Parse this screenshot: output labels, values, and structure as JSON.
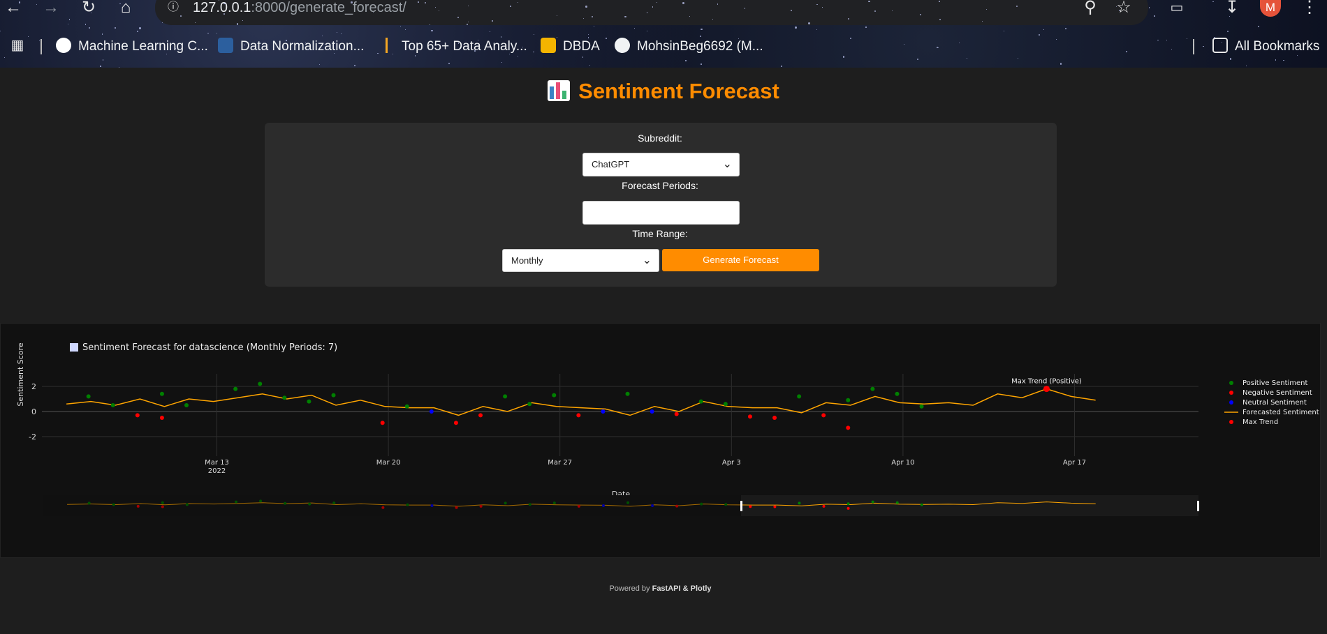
{
  "browser": {
    "url_host": "127.0.0.1",
    "url_rest": ":8000/generate_forecast/",
    "avatar_letter": "M",
    "bookmarks": [
      {
        "label": "Machine Learning C...",
        "icon": "google-icon"
      },
      {
        "label": "Data Normalization...",
        "icon": "site-icon"
      },
      {
        "label": "Top 65+ Data Analy...",
        "icon": "site-icon"
      },
      {
        "label": "DBDA",
        "icon": "classroom-icon"
      },
      {
        "label": "MohsinBeg6692 (M...",
        "icon": "github-icon"
      }
    ],
    "all_bookmarks_label": "All Bookmarks"
  },
  "page": {
    "title": "Sentiment Forecast",
    "footer_prefix": "Powered by ",
    "footer_strong": "FastAPI & Plotly"
  },
  "form": {
    "subreddit_label": "Subreddit:",
    "subreddit_value": "ChatGPT",
    "periods_label": "Forecast Periods:",
    "periods_value": "",
    "range_label": "Time Range:",
    "range_value": "Monthly",
    "generate_label": "Generate Forecast"
  },
  "colors": {
    "accent": "#ff8c00",
    "positive": "#008000",
    "negative": "#ff0000",
    "neutral": "#0000ff",
    "forecast": "#ffa500"
  },
  "chart_data": {
    "type": "scatter",
    "title": "Sentiment Forecast for datascience (Monthly Periods: 7)",
    "xlabel": "Date",
    "ylabel": "Sentiment Score",
    "x_ticks": [
      "Mar 13",
      "Mar 20",
      "Mar 27",
      "Apr 3",
      "Apr 10",
      "Apr 17"
    ],
    "x_tick_year": "2022",
    "y_ticks": [
      2,
      0,
      -2
    ],
    "ylim": [
      -3,
      3
    ],
    "legend": [
      "Positive Sentiment",
      "Negative Sentiment",
      "Neutral Sentiment",
      "Forecasted Sentiment",
      "Max Trend"
    ],
    "annotation": "Max Trend (Positive)",
    "positive": [
      [
        0.9,
        1.2
      ],
      [
        1.9,
        0.5
      ],
      [
        3.9,
        1.4
      ],
      [
        4.9,
        0.5
      ],
      [
        6.9,
        1.8
      ],
      [
        7.9,
        2.2
      ],
      [
        8.9,
        1.1
      ],
      [
        9.9,
        0.8
      ],
      [
        10.9,
        1.3
      ],
      [
        13.9,
        0.4
      ],
      [
        17.9,
        1.2
      ],
      [
        18.9,
        0.6
      ],
      [
        19.9,
        1.3
      ],
      [
        22.9,
        1.4
      ],
      [
        25.9,
        0.8
      ],
      [
        26.9,
        0.6
      ],
      [
        29.9,
        1.2
      ],
      [
        31.9,
        0.9
      ],
      [
        32.9,
        1.8
      ],
      [
        33.9,
        1.4
      ],
      [
        34.9,
        0.4
      ]
    ],
    "negative": [
      [
        2.9,
        -0.3
      ],
      [
        3.9,
        -0.5
      ],
      [
        12.9,
        -0.9
      ],
      [
        15.9,
        -0.9
      ],
      [
        16.9,
        -0.3
      ],
      [
        20.9,
        -0.3
      ],
      [
        24.9,
        -0.2
      ],
      [
        27.9,
        -0.4
      ],
      [
        28.9,
        -0.5
      ],
      [
        30.9,
        -0.3
      ],
      [
        31.9,
        -1.3
      ]
    ],
    "neutral": [
      [
        14.9,
        0.0
      ],
      [
        21.9,
        0.0
      ],
      [
        23.9,
        0.0
      ]
    ],
    "forecast": [
      [
        0,
        0.6
      ],
      [
        1,
        0.8
      ],
      [
        2,
        0.5
      ],
      [
        3,
        1.0
      ],
      [
        4,
        0.4
      ],
      [
        5,
        1.0
      ],
      [
        6,
        0.8
      ],
      [
        7,
        1.1
      ],
      [
        8,
        1.4
      ],
      [
        9,
        1.0
      ],
      [
        10,
        1.3
      ],
      [
        11,
        0.5
      ],
      [
        12,
        0.9
      ],
      [
        13,
        0.4
      ],
      [
        14,
        0.3
      ],
      [
        15,
        0.3
      ],
      [
        16,
        -0.3
      ],
      [
        17,
        0.4
      ],
      [
        18,
        0.0
      ],
      [
        19,
        0.7
      ],
      [
        20,
        0.4
      ],
      [
        21,
        0.3
      ],
      [
        22,
        0.2
      ],
      [
        23,
        -0.3
      ],
      [
        24,
        0.4
      ],
      [
        25,
        0.0
      ],
      [
        26,
        0.8
      ],
      [
        27,
        0.4
      ],
      [
        28,
        0.3
      ],
      [
        29,
        0.3
      ],
      [
        30,
        -0.1
      ],
      [
        31,
        0.7
      ],
      [
        32,
        0.5
      ],
      [
        33,
        1.2
      ],
      [
        34,
        0.7
      ],
      [
        35,
        0.6
      ],
      [
        36,
        0.7
      ],
      [
        37,
        0.5
      ],
      [
        38,
        1.4
      ],
      [
        39,
        1.1
      ],
      [
        40,
        1.8
      ],
      [
        41,
        1.2
      ],
      [
        42,
        0.9
      ]
    ],
    "max_trend": [
      [
        40,
        1.8
      ]
    ],
    "x_tick_positions": [
      6.14,
      13.14,
      20.14,
      27.14,
      34.14,
      41.14
    ],
    "xlim": [
      -1,
      46.2
    ]
  }
}
